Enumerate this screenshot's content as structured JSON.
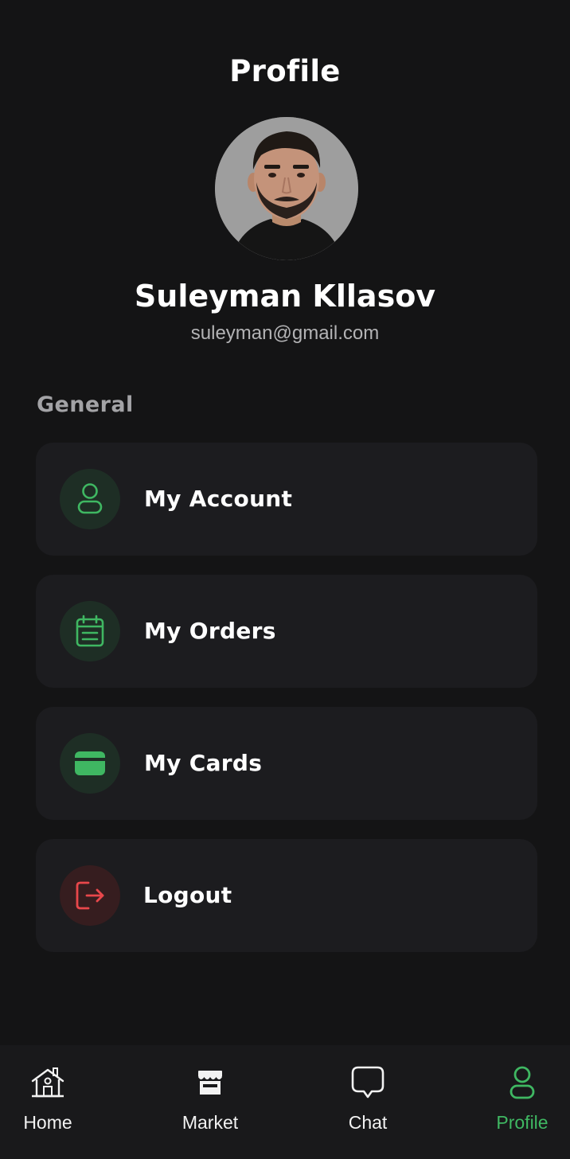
{
  "header": {
    "title": "Profile"
  },
  "user": {
    "name": "Suleyman Kllasov",
    "email": "suleyman@gmail.com",
    "avatar_icon": "profile-photo"
  },
  "general": {
    "label": "General",
    "items": [
      {
        "label": "My Account",
        "icon": "user-icon",
        "accent": "#3fb762"
      },
      {
        "label": "My Orders",
        "icon": "calendar-icon",
        "accent": "#3fb762"
      },
      {
        "label": "My Cards",
        "icon": "card-icon",
        "accent": "#3fb762"
      },
      {
        "label": "Logout",
        "icon": "logout-icon",
        "accent": "#e8474b"
      }
    ]
  },
  "bottom_nav": {
    "items": [
      {
        "label": "Home",
        "icon": "home-icon",
        "active": false
      },
      {
        "label": "Market",
        "icon": "store-icon",
        "active": false
      },
      {
        "label": "Chat",
        "icon": "chat-icon",
        "active": false
      },
      {
        "label": "Profile",
        "icon": "user-icon",
        "active": true
      }
    ],
    "active_color": "#3fb762"
  },
  "colors": {
    "background": "#141415",
    "card": "#1c1c1f",
    "accent_green": "#3fb762",
    "accent_red": "#e8474b"
  }
}
